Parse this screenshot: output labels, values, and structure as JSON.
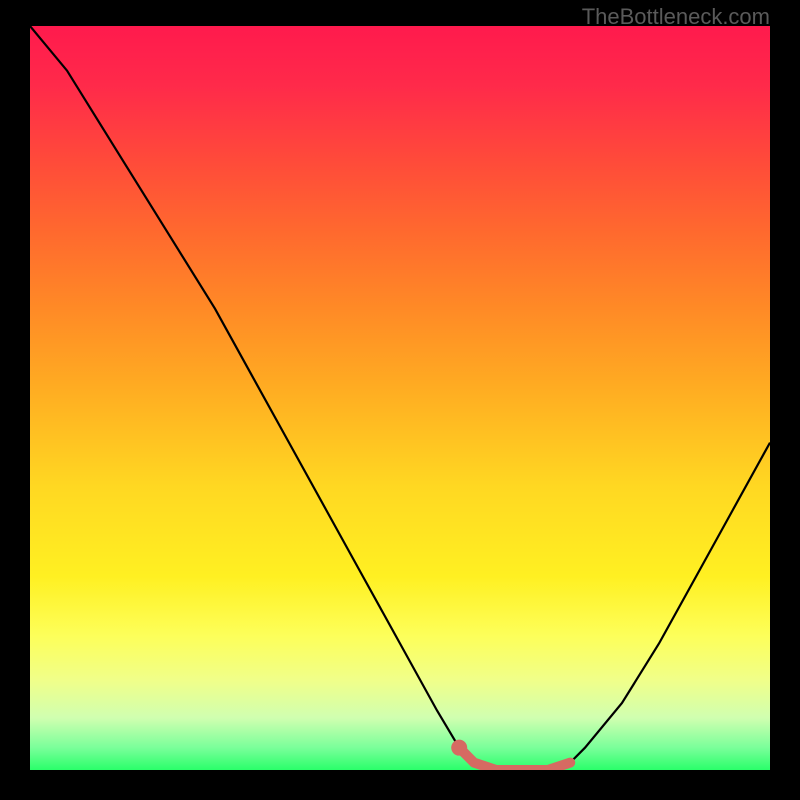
{
  "watermark": "TheBottleneck.com",
  "chart_data": {
    "type": "line",
    "title": "",
    "xlabel": "",
    "ylabel": "",
    "xlim": [
      0,
      100
    ],
    "ylim": [
      0,
      100
    ],
    "series": [
      {
        "name": "bottleneck-curve",
        "x": [
          0,
          5,
          10,
          15,
          20,
          25,
          30,
          35,
          40,
          45,
          50,
          55,
          58,
          60,
          63,
          66,
          70,
          73,
          75,
          80,
          85,
          90,
          95,
          100
        ],
        "values": [
          100,
          94,
          86,
          78,
          70,
          62,
          53,
          44,
          35,
          26,
          17,
          8,
          3,
          1,
          0,
          0,
          0,
          1,
          3,
          9,
          17,
          26,
          35,
          44
        ],
        "color": "#000000"
      },
      {
        "name": "highlight-segment",
        "x": [
          58,
          60,
          63,
          66,
          70,
          73
        ],
        "values": [
          3,
          1,
          0,
          0,
          0,
          1
        ],
        "color": "#d66a62",
        "stroke_width": 10
      }
    ],
    "markers": [
      {
        "name": "highlight-dot",
        "x": 58,
        "y": 3,
        "color": "#d66a62",
        "r": 8
      }
    ]
  }
}
